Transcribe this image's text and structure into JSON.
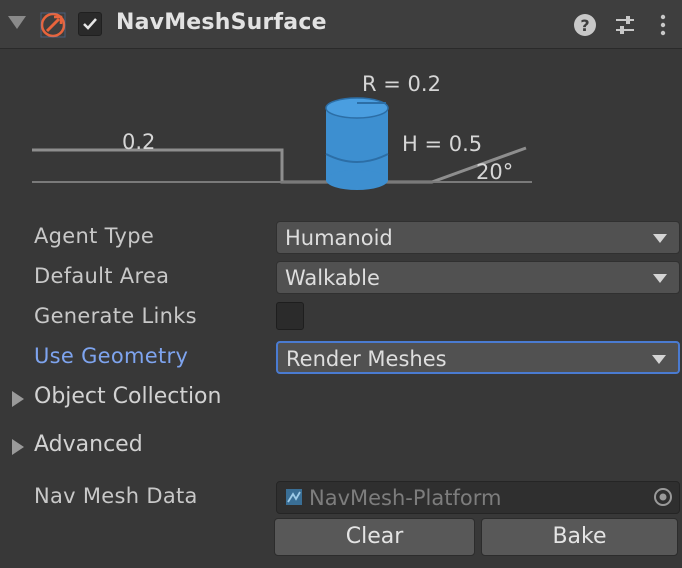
{
  "header": {
    "title": "NavMeshSurface",
    "enabled": true
  },
  "diagram": {
    "step_height": "0.2",
    "radius": "R = 0.2",
    "height": "H = 0.5",
    "slope": "20°"
  },
  "fields": {
    "agent_type": {
      "label": "Agent Type",
      "value": "Humanoid"
    },
    "default_area": {
      "label": "Default Area",
      "value": "Walkable"
    },
    "generate_links": {
      "label": "Generate Links",
      "checked": false
    },
    "use_geometry": {
      "label": "Use Geometry",
      "value": "Render Meshes"
    }
  },
  "foldouts": {
    "object_collection": "Object Collection",
    "advanced": "Advanced"
  },
  "nav_mesh_data": {
    "label": "Nav Mesh Data",
    "value": "NavMesh-Platform"
  },
  "buttons": {
    "clear": "Clear",
    "bake": "Bake"
  },
  "colors": {
    "accent": "#4a7bd1",
    "active_label": "#7ea4ef",
    "agent_cylinder": "#3d8fd0",
    "component_icon": "#e8643c"
  }
}
